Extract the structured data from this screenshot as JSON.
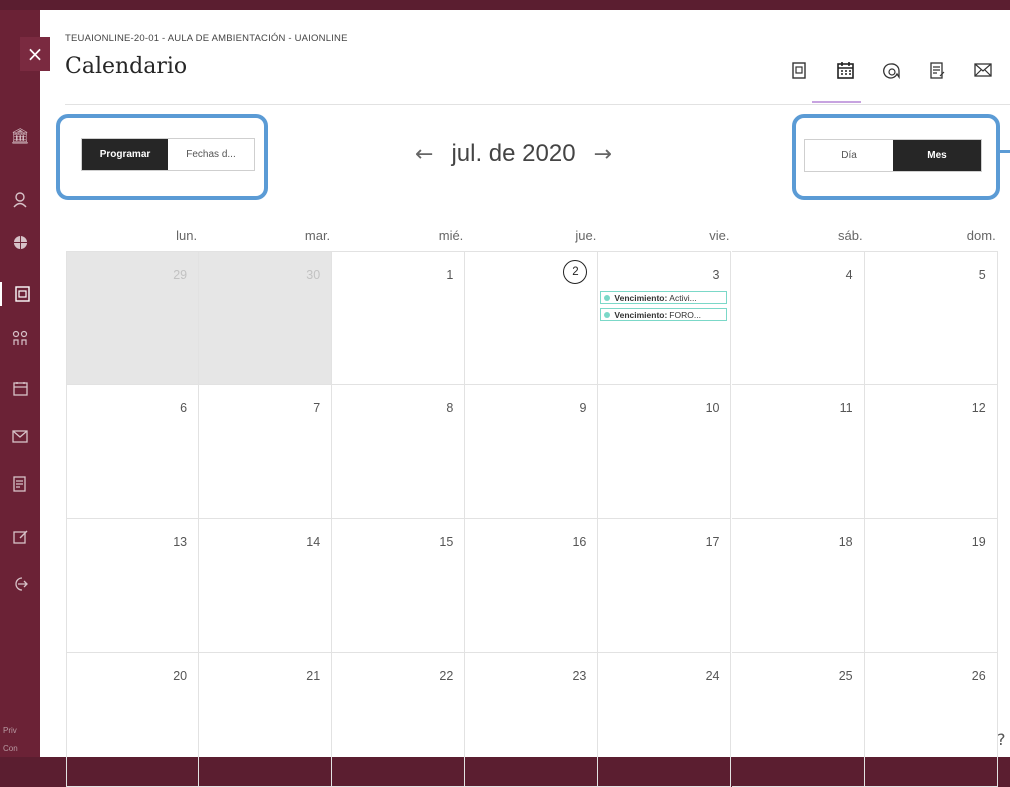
{
  "header": {
    "course_name": "TEUAIONLINE-20-01 - AULA DE AMBIENTACIÓN - UAIONLINE",
    "title": "Calendario",
    "close_label": "×",
    "icons": [
      "content-icon",
      "calendar-icon",
      "discussions-icon",
      "gradebook-icon",
      "messages-icon"
    ]
  },
  "view_toggle": {
    "schedule": "Programar",
    "due_dates": "Fechas d..."
  },
  "period_toggle": {
    "day": "Día",
    "month": "Mes"
  },
  "month_nav": {
    "prev": "←",
    "label": "jul. de 2020",
    "next": "→"
  },
  "weekdays": [
    "lun.",
    "mar.",
    "mié.",
    "jue.",
    "vie.",
    "sáb.",
    "dom."
  ],
  "weeks": [
    [
      {
        "day": "29",
        "out": true
      },
      {
        "day": "30",
        "out": true
      },
      {
        "day": "1"
      },
      {
        "day": "2",
        "today": true
      },
      {
        "day": "3",
        "events": [
          {
            "prefix": "Vencimiento:",
            "text": "Activi..."
          },
          {
            "prefix": "Vencimiento:",
            "text": "FORO..."
          }
        ]
      },
      {
        "day": "4"
      },
      {
        "day": "5"
      }
    ],
    [
      {
        "day": "6"
      },
      {
        "day": "7"
      },
      {
        "day": "8"
      },
      {
        "day": "9"
      },
      {
        "day": "10"
      },
      {
        "day": "11"
      },
      {
        "day": "12"
      }
    ],
    [
      {
        "day": "13"
      },
      {
        "day": "14"
      },
      {
        "day": "15"
      },
      {
        "day": "16"
      },
      {
        "day": "17"
      },
      {
        "day": "18"
      },
      {
        "day": "19"
      }
    ],
    [
      {
        "day": "20"
      },
      {
        "day": "21"
      },
      {
        "day": "22"
      },
      {
        "day": "23"
      },
      {
        "day": "24"
      },
      {
        "day": "25"
      },
      {
        "day": "26"
      }
    ]
  ],
  "leftnav": {
    "icons": [
      "institution-icon",
      "user-icon",
      "globe-icon",
      "courses-icon",
      "organizations-icon",
      "calendar-icon",
      "messages-icon",
      "grades-icon",
      "tools-icon",
      "sign-out-icon"
    ],
    "footer_1": "Priv",
    "footer_2": "Con"
  },
  "help_icon": "?"
}
